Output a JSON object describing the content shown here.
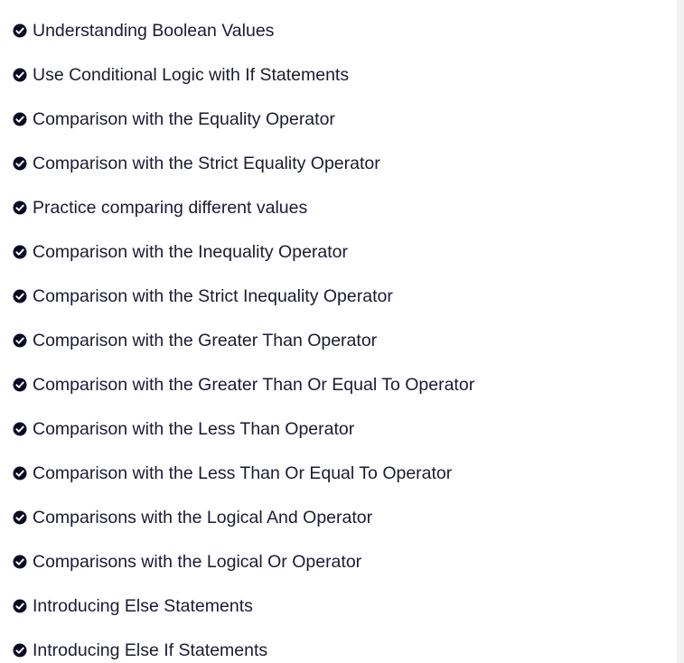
{
  "challenges": {
    "icon": "check-circle-icon",
    "icon_color": "#0a0a23",
    "items": [
      {
        "label": "Understanding Boolean Values",
        "completed": true
      },
      {
        "label": "Use Conditional Logic with If Statements",
        "completed": true
      },
      {
        "label": "Comparison with the Equality Operator",
        "completed": true
      },
      {
        "label": "Comparison with the Strict Equality Operator",
        "completed": true
      },
      {
        "label": "Practice comparing different values",
        "completed": true
      },
      {
        "label": "Comparison with the Inequality Operator",
        "completed": true
      },
      {
        "label": "Comparison with the Strict Inequality Operator",
        "completed": true
      },
      {
        "label": "Comparison with the Greater Than Operator",
        "completed": true
      },
      {
        "label": "Comparison with the Greater Than Or Equal To Operator",
        "completed": true
      },
      {
        "label": "Comparison with the Less Than Operator",
        "completed": true
      },
      {
        "label": "Comparison with the Less Than Or Equal To Operator",
        "completed": true
      },
      {
        "label": "Comparisons with the Logical And Operator",
        "completed": true
      },
      {
        "label": "Comparisons with the Logical Or Operator",
        "completed": true
      },
      {
        "label": "Introducing Else Statements",
        "completed": true
      },
      {
        "label": "Introducing Else If Statements",
        "completed": true
      }
    ]
  }
}
